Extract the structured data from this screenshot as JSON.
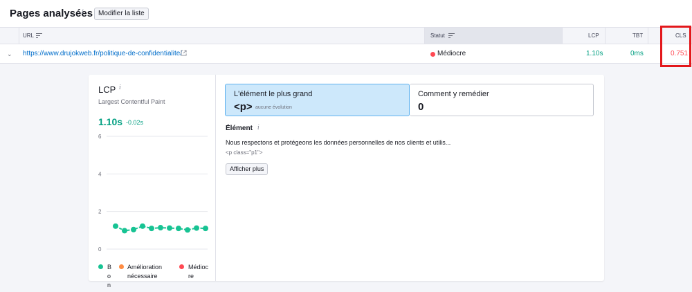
{
  "header": {
    "title": "Pages analysées",
    "info_icon": "i",
    "modify_button": "Modifier la liste"
  },
  "table": {
    "columns": [
      "URL",
      "Statut",
      "LCP",
      "TBT",
      "CLS"
    ],
    "rows": [
      {
        "url": "https://www.drujokweb.fr/politique-de-confidentialite/",
        "status": "Médiocre",
        "status_color": "#ff4953",
        "lcp": "1.10s",
        "tbt": "0ms",
        "cls": "0.751"
      }
    ]
  },
  "colors": {
    "good": "#009f81",
    "bad": "#ff4953",
    "needs_improvement": "#ff8c43",
    "highlight_box": "#e3171b",
    "link": "#006dca"
  },
  "lcp_panel": {
    "title": "LCP",
    "info_icon": "i",
    "subtitle": "Largest Contentful Paint",
    "value": "1.10s",
    "delta": "-0.02s",
    "legend": [
      {
        "label": "Bon",
        "color": "#17c393"
      },
      {
        "label": "Amélioration nécessaire",
        "color": "#ff8c43"
      },
      {
        "label": "Médiocre",
        "color": "#ff4953"
      }
    ]
  },
  "chart_data": {
    "type": "line",
    "title": "",
    "xlabel": "",
    "ylabel": "",
    "ylim": [
      0,
      6
    ],
    "yticks": [
      "6",
      "4",
      "2",
      "0"
    ],
    "grid": true,
    "series": [
      {
        "values": [
          1.22,
          0.98,
          1.04,
          1.22,
          1.1,
          1.14,
          1.12,
          1.1,
          1.02,
          1.12,
          1.1
        ]
      }
    ]
  },
  "detail": {
    "cards": [
      {
        "label": "L'élément le plus grand",
        "value": "<p>",
        "note": "aucune évolution"
      },
      {
        "label": "Comment y remédier",
        "value": "0"
      }
    ],
    "element_heading": "Élément",
    "element_text": "Nous respectons et protégeons les données personnelles de nos clients et utilis...",
    "element_code": "<p class=\"p1\">",
    "show_more_button": "Afficher plus"
  }
}
